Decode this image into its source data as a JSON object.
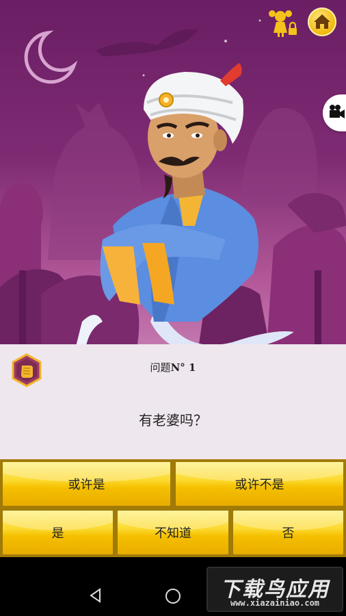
{
  "game": {
    "question_label": "问题",
    "question_number": "N° 1",
    "question_text": "有老婆吗？"
  },
  "answers": {
    "row1": [
      "或许是",
      "或许不是"
    ],
    "row2": [
      "是",
      "不知道",
      "否"
    ]
  },
  "icons": {
    "home": "home-icon",
    "profile": "girl-lock-icon",
    "video": "video-camera-icon",
    "badge": "hand-badge-icon"
  },
  "watermark": {
    "title": "下载鸟应用",
    "url": "www.xiazainiao.com"
  },
  "colors": {
    "sky": "#6a1e63",
    "button_gold": "#fcd92e",
    "panel": "#efe7ee",
    "genie_robe": "#5b8de0"
  }
}
